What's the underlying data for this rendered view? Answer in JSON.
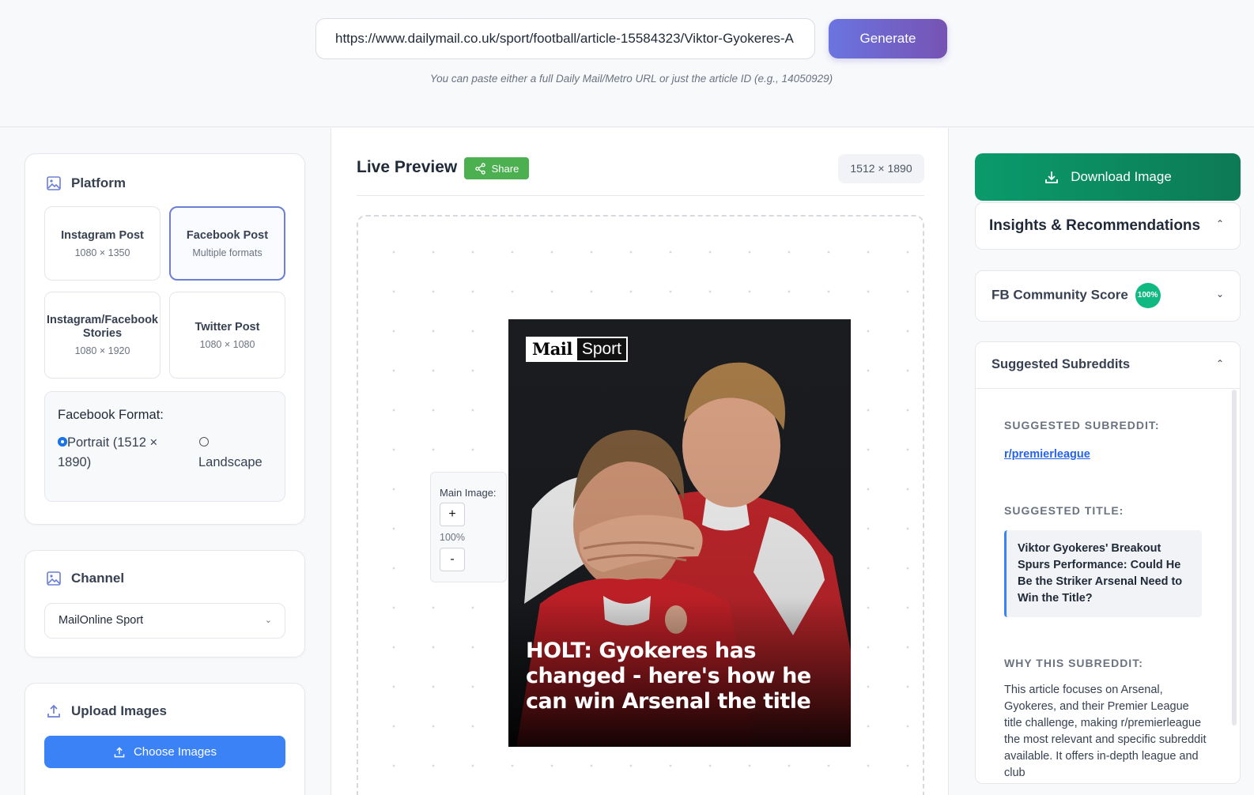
{
  "header": {
    "url_value": "https://www.dailymail.co.uk/sport/football/article-15584323/Viktor-Gyokeres-A",
    "generate_label": "Generate",
    "hint": "You can paste either a full Daily Mail/Metro URL or just the article ID (e.g., 14050929)"
  },
  "platform": {
    "title": "Platform",
    "options": [
      {
        "name": "Instagram Post",
        "sub": "1080 × 1350",
        "active": false
      },
      {
        "name": "Facebook Post",
        "sub": "Multiple formats",
        "active": true
      },
      {
        "name": "Instagram/Facebook Stories",
        "sub": "1080 × 1920",
        "active": false
      },
      {
        "name": "Twitter Post",
        "sub": "1080 × 1080",
        "active": false
      }
    ],
    "fb_format": {
      "label": "Facebook Format:",
      "portrait": "Portrait (1512 × 1890)",
      "landscape": "Landscape",
      "selected": "portrait"
    }
  },
  "channel": {
    "title": "Channel",
    "selected": "MailOnline Sport"
  },
  "upload": {
    "title": "Upload Images",
    "button": "Choose Images"
  },
  "preview": {
    "title": "Live Preview",
    "share": "Share",
    "dims": "1512 × 1890",
    "zoom_label": "Main Image:",
    "zoom_in": "+",
    "zoom_value": "100%",
    "zoom_out": "-",
    "logo_left": "Mail",
    "logo_right": "Sport",
    "headline": "HOLT: Gyokeres has changed - here's how he can win Arsenal the title"
  },
  "right": {
    "download": "Download Image",
    "insights_title": "Insights & Recommendations",
    "fb_score_label": "FB Community Score",
    "fb_score_value": "100%",
    "subreddits_title": "Suggested Subreddits",
    "suggested_subreddit_head": "SUGGESTED SUBREDDIT:",
    "subreddit": "r/premierleague",
    "suggested_title_head": "SUGGESTED TITLE:",
    "suggested_title": "Viktor Gyokeres' Breakout Spurs Performance: Could He Be the Striker Arsenal Need to Win the Title?",
    "why_head": "WHY THIS SUBREDDIT:",
    "why_text": "This article focuses on Arsenal, Gyokeres, and their Premier League title challenge, making r/premierleague the most relevant and specific subreddit available. It offers in-depth league and club"
  },
  "colors": {
    "accent_blue": "#3b82f6",
    "generate_gradient": "#6b74e0",
    "download_green": "#0a9b6b",
    "share_green": "#4caf50",
    "score_green": "#10b981"
  }
}
